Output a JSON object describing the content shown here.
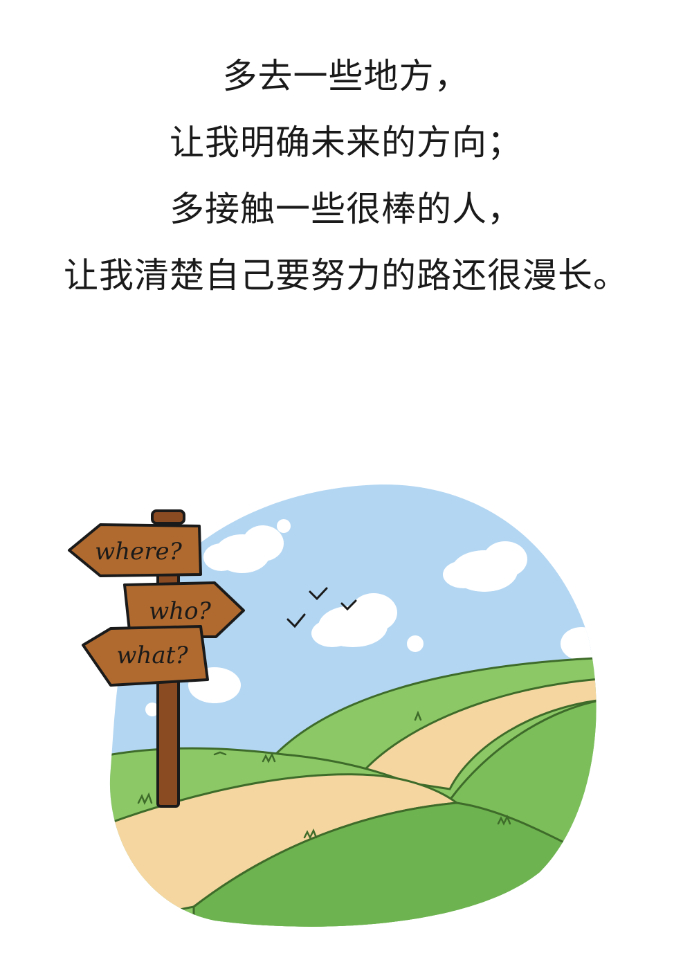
{
  "poem": {
    "line1": "多去一些地方，",
    "line2": "让我明确未来的方向；",
    "line3": "多接触一些很棒的人，",
    "line4": "让我清楚自己要努力的路还很漫长。"
  },
  "signpost": {
    "sign1": "where?",
    "sign2": "who?",
    "sign3": "what?"
  },
  "colors": {
    "sky": "#b3d6f2",
    "grass_light": "#8cc966",
    "grass_dark": "#6db34f",
    "path": "#f5d6a0",
    "wood": "#b06a2f",
    "wood_dark": "#6b3b18",
    "text": "#1a1a1a"
  },
  "icons": [
    "signpost-icon",
    "bird-icon",
    "cloud-icon"
  ]
}
